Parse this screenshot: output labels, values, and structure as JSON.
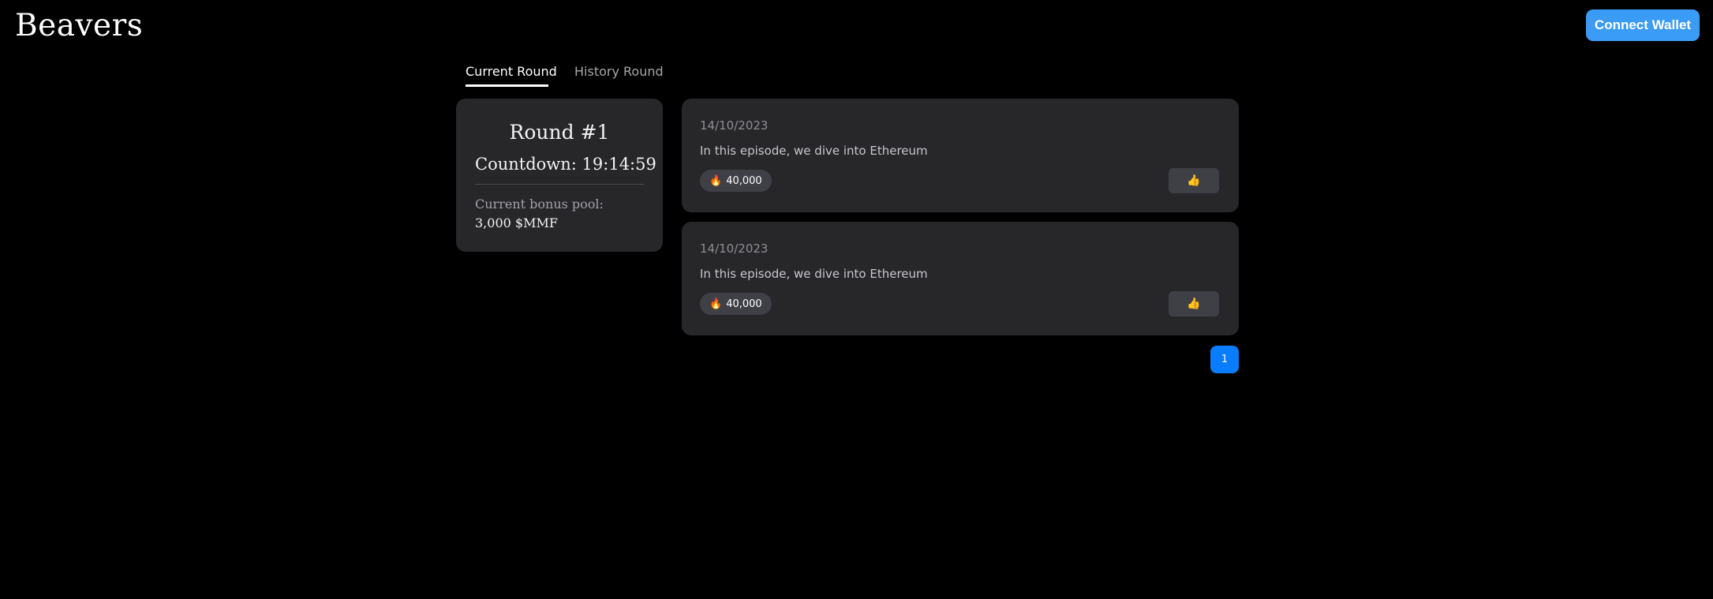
{
  "header": {
    "logo": "Beavers",
    "connect_wallet_label": "Connect Wallet"
  },
  "tabs": [
    {
      "label": "Current Round",
      "active": true
    },
    {
      "label": "History Round",
      "active": false
    }
  ],
  "round": {
    "title": "Round #1",
    "countdown": "Countdown: 19:14:59",
    "bonus_pool_label": "Current bonus pool:",
    "bonus_pool_value": "3,000 $MMF"
  },
  "episodes": [
    {
      "date": "14/10/2023",
      "description": "In this episode, we dive into Ethereum",
      "heat_icon": "fire-icon",
      "heat_count": "40,000",
      "like_icon": "thumbs-up-icon",
      "like_glyph": "👍"
    },
    {
      "date": "14/10/2023",
      "description": "In this episode, we dive into Ethereum",
      "heat_icon": "fire-icon",
      "heat_count": "40,000",
      "like_icon": "thumbs-up-icon",
      "like_glyph": "👍"
    }
  ],
  "pagination": {
    "current_page": "1"
  },
  "colors": {
    "background": "#000000",
    "card": "#27272a",
    "accent_button": "#3b9cf7",
    "pagination_active": "#0a7cff",
    "badge": "#3f3f46"
  }
}
